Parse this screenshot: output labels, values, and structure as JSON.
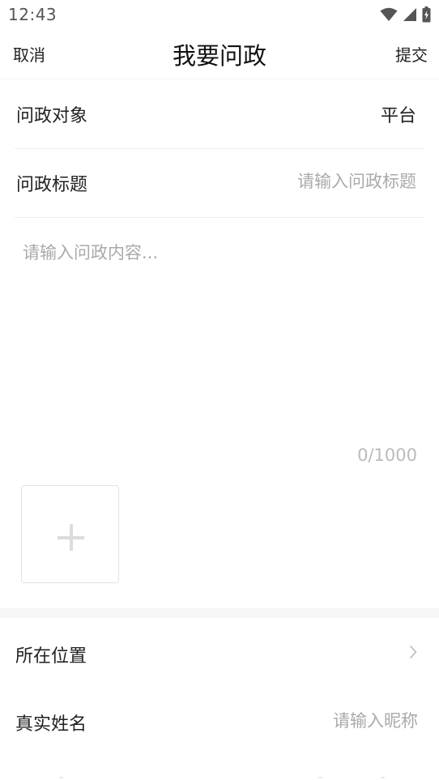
{
  "status_bar": {
    "time": "12:43",
    "icons": [
      "wifi-icon",
      "cellular-signal-icon",
      "battery-charging-icon"
    ]
  },
  "nav": {
    "cancel_label": "取消",
    "title": "我要问政",
    "submit_label": "提交"
  },
  "form": {
    "target_label": "问政对象",
    "target_value": "平台",
    "title_label": "问政标题",
    "title_value": "",
    "title_placeholder": "请输入问政标题",
    "content_value": "",
    "content_placeholder": "请输入问政内容...",
    "char_count": "0/1000",
    "upload_icon": "plus-icon"
  },
  "info": {
    "location_label": "所在位置",
    "location_icon": "chevron-right-icon",
    "name_label": "真实姓名",
    "name_value": "",
    "name_placeholder": "请输入昵称"
  },
  "colors": {
    "text_primary": "#222222",
    "placeholder": "#aaaaaa",
    "divider": "#eeeeee",
    "section_background": "#f6f6f6"
  }
}
